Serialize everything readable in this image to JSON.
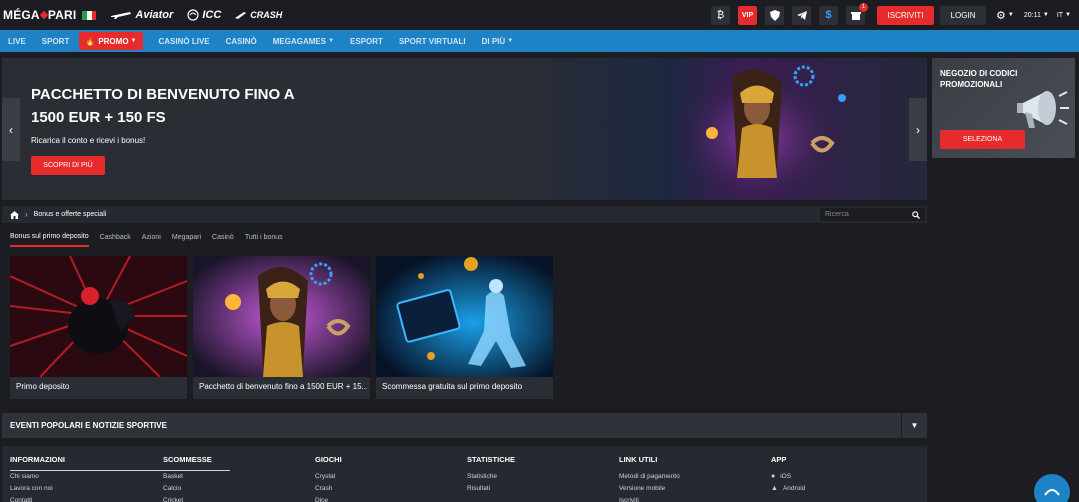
{
  "header": {
    "logo_text_1": "MÉGA",
    "logo_text_2": "PARI",
    "partners": [
      "Aviator",
      "ICC",
      "CRASH"
    ],
    "icons": [
      "bitcoin-icon",
      "vip-icon",
      "shield-icon",
      "telegram-icon",
      "dollar-icon",
      "gift-icon"
    ],
    "vip_label": "VIP",
    "bitcoin_symbol": "₿",
    "dollar_symbol": "$",
    "gift_badge": "1",
    "signup_label": "ISCRIVITI",
    "login_label": "LOGIN",
    "time": "20:11",
    "language": "IT"
  },
  "nav": {
    "items": [
      "LIVE",
      "SPORT",
      "PROMO",
      "CASINÒ LIVE",
      "CASINÒ",
      "MEGAGAMES",
      "ESPORT",
      "SPORT VIRTUALI",
      "DI PIÙ"
    ]
  },
  "banner": {
    "title_line1": "PACCHETTO DI BENVENUTO FINO A",
    "title_line2": "1500 EUR + 150 FS",
    "subtitle": "Ricarica il conto e ricevi i bonus!",
    "button_label": "SCOPRI DI PIÙ"
  },
  "side_promo": {
    "title": "NEGOZIO DI CODICI PROMOZIONALI",
    "button_label": "SELEZIONA"
  },
  "breadcrumb": {
    "current": "Bonus e offerte speciali",
    "search_placeholder": "Ricerca"
  },
  "tabs": [
    "Bonus sul primo deposito",
    "Cashback",
    "Azioni",
    "Megapari",
    "Casinò",
    "Tutti i bonus"
  ],
  "cards": [
    {
      "caption": "Primo deposito"
    },
    {
      "caption": "Pacchetto di benvenuto fino a 1500 EUR + 15..."
    },
    {
      "caption": "Scommessa gratuita sul primo deposito"
    }
  ],
  "events": {
    "title": "EVENTI POPOLARI E NOTIZIE SPORTIVE"
  },
  "footer": {
    "columns": [
      {
        "title": "INFORMAZIONI",
        "items": [
          "Chi siamo",
          "Lavora con noi",
          "Contatti"
        ]
      },
      {
        "title": "SCOMMESSE",
        "items": [
          "Basket",
          "Calcio",
          "Cricket"
        ]
      },
      {
        "title": "GIOCHI",
        "items": [
          "Crystal",
          "Crash",
          "Dice"
        ]
      },
      {
        "title": "STATISTICHE",
        "items": [
          "Statistiche",
          "Risultati"
        ]
      },
      {
        "title": "LINK UTILI",
        "items": [
          "Metodi di pagamento",
          "Versione mobile",
          "Iscriviti"
        ]
      },
      {
        "title": "APP",
        "items": [
          "iOS",
          "Android"
        ]
      }
    ]
  },
  "colors": {
    "accent_red": "#e52b2b",
    "nav_blue": "#1e82c7",
    "background": "#1b1d22"
  }
}
